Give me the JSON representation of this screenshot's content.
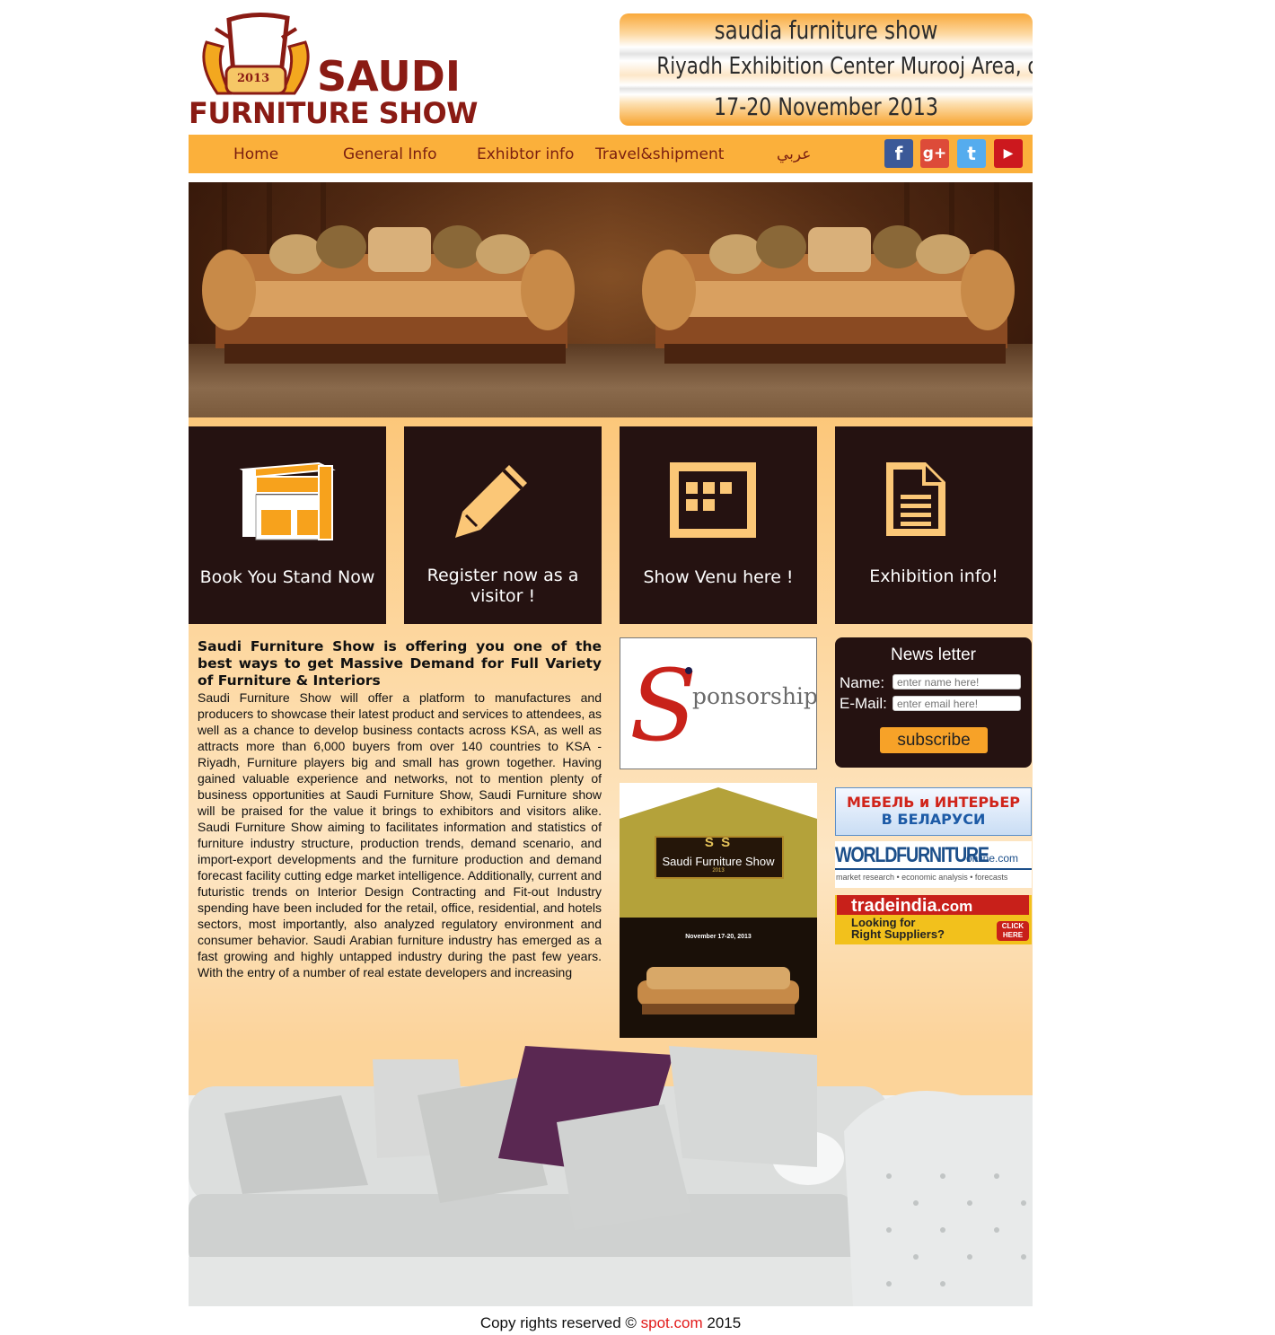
{
  "logo": {
    "year": "2013",
    "line1": "SAUDI",
    "line2": "FURNITURE SHOW"
  },
  "header_info": {
    "line1": "saudia furniture show",
    "line2": "Riyadh Exhibition Center Murooj Area, olaya sreet",
    "line3": "17-20 November 2013"
  },
  "nav": {
    "items": [
      "Home",
      "General Info",
      "Exhibtor info",
      "Travel&shipment",
      "عربي"
    ],
    "social": [
      {
        "icon": "facebook-icon",
        "glyph": "f",
        "color": "#3b5998"
      },
      {
        "icon": "google-plus-icon",
        "glyph": "g+",
        "color": "#dd4b39"
      },
      {
        "icon": "twitter-icon",
        "glyph": "t",
        "color": "#55acee"
      },
      {
        "icon": "youtube-icon",
        "glyph": "▶",
        "color": "#cc181e"
      }
    ]
  },
  "tiles": [
    {
      "label": "Book You Stand Now",
      "icon": "booth-icon"
    },
    {
      "label": "Register now as a visitor !",
      "icon": "pencil-icon"
    },
    {
      "label": "Show Venu here !",
      "icon": "calendar-grid-icon"
    },
    {
      "label": "Exhibition info!",
      "icon": "document-icon"
    }
  ],
  "article": {
    "heading": "Saudi Furniture Show is offering you one of the best ways to get Massive Demand for Full Variety of Furniture & Interiors",
    "body": "Saudi Furniture Show will offer a platform to manufactures and producers to showcase their latest product and services to attendees, as well as a chance to develop business contacts across KSA, as well as attracts more than 6,000 buyers from over 140 countries to KSA - Riyadh, Furniture players big and small has grown together. Having gained valuable experience and networks, not to mention plenty of business opportunities at Saudi Furniture Show, Saudi Furniture show will be praised for the value it brings to exhibitors and visitors alike. Saudi Furniture Show aiming to facilitates information and statistics of furniture industry structure, production trends, demand scenario, and import-export developments and the furniture production and demand forecast facility cutting edge market intelligence. Additionally, current and futuristic trends on Interior Design Contracting and Fit-out Industry spending have been included for the retail, office, residential, and hotels sectors, most importantly, also analyzed regulatory environment and consumer behavior. Saudi Arabian furniture industry has emerged as a fast growing and highly untapped industry during the past few years. With the entry of a number of real estate developers and increasing"
  },
  "ads": {
    "sponsorship": {
      "letter": "S",
      "text": "ponsorship"
    },
    "poster": {
      "brand": "Saudi Furniture Show",
      "mono": "S S",
      "year": "2013",
      "date": "November 17-20, 2013"
    },
    "belarus": {
      "line1": "МЕБЕЛЬ и ИНТЕРЬЕР",
      "line2": "В БЕЛАРУСИ"
    },
    "worldfurniture": {
      "main": "WORLDFURNITURE",
      "suffix": "online.com",
      "tagline": "market research • economic analysis • forecasts"
    },
    "tradeindia": {
      "brand": "tradeindia",
      "tld": ".com",
      "line1": "Looking for",
      "line2": "Right Suppliers?",
      "cta": "CLICK HERE"
    }
  },
  "newsletter": {
    "title": "News letter",
    "name_label": "Name:",
    "name_placeholder": "enter name here!",
    "email_label": "E-Mail:",
    "email_placeholder": "enter email here!",
    "button": "subscribe"
  },
  "footer": {
    "prefix": "Copy rights reserved ©",
    "link": "spot.com",
    "year": "2015"
  },
  "colors": {
    "accent": "#fbb03b",
    "brand_dark": "#8a1b14",
    "tile_bg": "#251211",
    "nav_text": "#7a1f10"
  }
}
